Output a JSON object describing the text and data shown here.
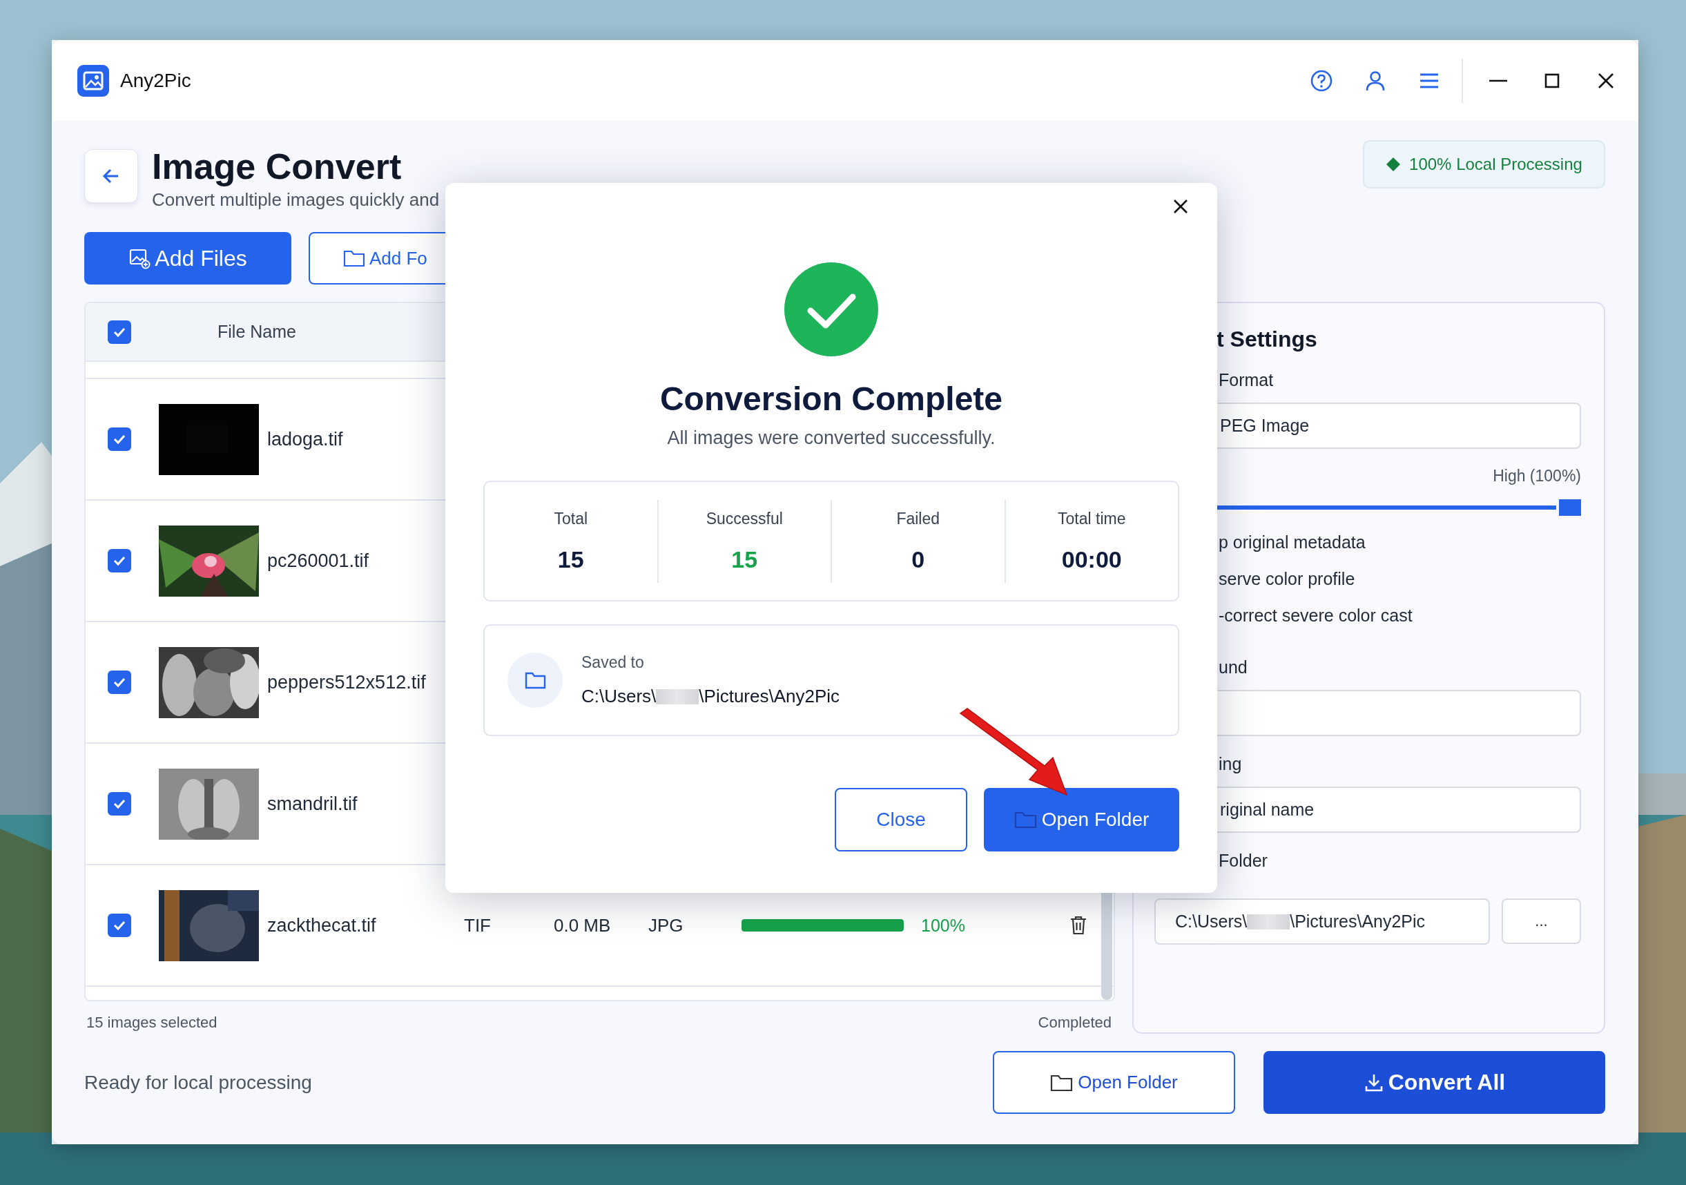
{
  "app": {
    "name": "Any2Pic"
  },
  "page": {
    "title": "Image Convert",
    "subtitle": "Convert multiple images quickly and",
    "badge": "100% Local Processing"
  },
  "toolbar": [
    {
      "label": "Add Files",
      "kind": "primary"
    },
    {
      "label": "Add Fo",
      "kind": "outline"
    }
  ],
  "table": {
    "header": {
      "checked": true,
      "file_name": "File Name"
    },
    "rows": [
      {
        "checked": true,
        "name": "ladoga.tif"
      },
      {
        "checked": true,
        "name": "pc260001.tif"
      },
      {
        "checked": true,
        "name": "peppers512x512.tif"
      },
      {
        "checked": true,
        "name": "smandril.tif"
      },
      {
        "checked": true,
        "name": "zackthecat.tif",
        "type": "TIF",
        "size": "0.0 MB",
        "output": "JPG",
        "level": 1,
        "percent": "100%"
      }
    ]
  },
  "selection_count": "15 images selected",
  "queue_status": "Completed",
  "settings": {
    "title": "t Settings",
    "format_label": "Format",
    "format_value": "PEG Image",
    "quality": {
      "reading": "High (100%)",
      "level": 1
    },
    "options": [
      "p original metadata",
      "serve color profile",
      "-correct severe color cast"
    ],
    "background_label": "und",
    "naming_label": "ing",
    "naming_value": "riginal name",
    "folder_label": "Folder",
    "folder_path": {
      "before": "C:\\Users\\",
      "after": "\\Pictures\\Any2Pic"
    },
    "browse": "..."
  },
  "footer": {
    "status": "Ready for local processing",
    "buttons": [
      {
        "label": "Open Folder",
        "kind": "outline"
      },
      {
        "label": "Convert All",
        "kind": "primary"
      }
    ]
  },
  "dialog": {
    "title": "Conversion Complete",
    "message": "All images were converted successfully.",
    "stats": [
      {
        "label": "Total",
        "value": "15",
        "color": "#0f1b3d"
      },
      {
        "label": "Successful",
        "value": "15",
        "color": "#16a34a"
      },
      {
        "label": "Failed",
        "value": "0",
        "color": "#0f1b3d"
      },
      {
        "label": "Total time",
        "value": "00:00",
        "color": "#0f1b3d"
      }
    ],
    "saved_label": "Saved to",
    "saved_path": {
      "before": "C:\\Users\\",
      "after": "\\Pictures\\Any2Pic"
    },
    "buttons": [
      {
        "label": "Close",
        "kind": "secondary"
      },
      {
        "label": "Open Folder",
        "kind": "primary"
      }
    ]
  }
}
